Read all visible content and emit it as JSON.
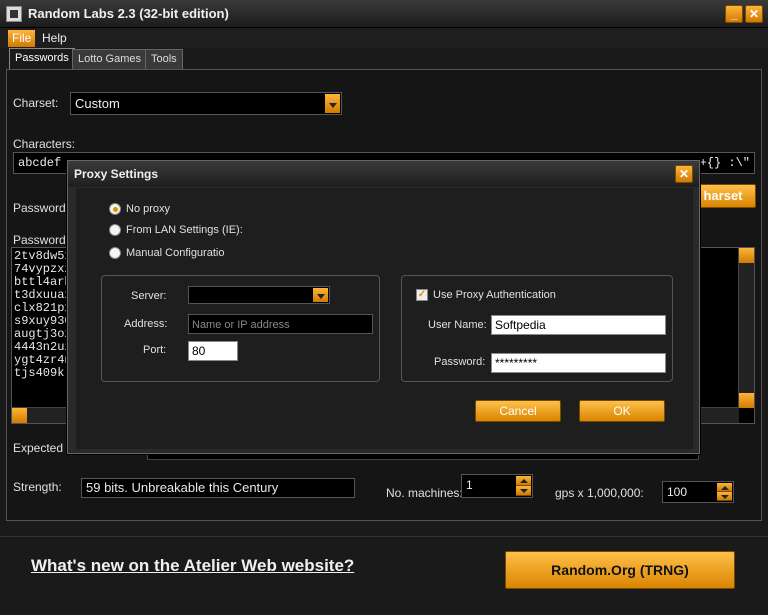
{
  "window": {
    "title": "Random Labs 2.3 (32-bit edition)",
    "min": "_",
    "max": "□",
    "close": "✕"
  },
  "menu": {
    "file": "File",
    "help": "Help"
  },
  "tabs": [
    "Passwords",
    "Lotto Games",
    "Tools"
  ],
  "main": {
    "charset_label": "Charset:",
    "charset_value": "Custom",
    "characters_label": "Characters:",
    "characters_start": "abcdef",
    "characters_end": "+{} :\\\"",
    "password_length_label": "Password L",
    "charset_button": "harset",
    "passwords_label": "Passwords:",
    "passwords": [
      "2tv8dw51",
      "74vypzxz",
      "bttl4arh",
      "t3dxuuax",
      "clx821px",
      "s9xuy930",
      "augtj3oz",
      "4443n2ui",
      "ygt4zr4n",
      "tjs409kl"
    ],
    "expected_label": "Expected T",
    "strength_label": "Strength:",
    "strength_value": "59 bits. Unbreakable this Century",
    "machines_label": "No. machines:",
    "machines_value": "1",
    "gps_label": "gps x 1,000,000:",
    "gps_value": "100"
  },
  "footer": {
    "link": "What's new on the Atelier Web website?",
    "trng_button": "Random.Org (TRNG)"
  },
  "dialog": {
    "title": "Proxy Settings",
    "close": "✕",
    "radio_no_proxy": "No proxy",
    "radio_lan": "From LAN Settings (IE):",
    "radio_manual": "Manual Configuratio",
    "server_label": "Server:",
    "address_label": "Address:",
    "address_placeholder": "Name or IP address",
    "port_label": "Port:",
    "port_value": "80",
    "use_auth_label": "Use Proxy Authentication",
    "check_mark": "✓",
    "username_label": "User Name:",
    "username_value": "Softpedia",
    "password_label": "Password:",
    "password_value": "*********",
    "cancel": "Cancel",
    "ok": "OK"
  }
}
